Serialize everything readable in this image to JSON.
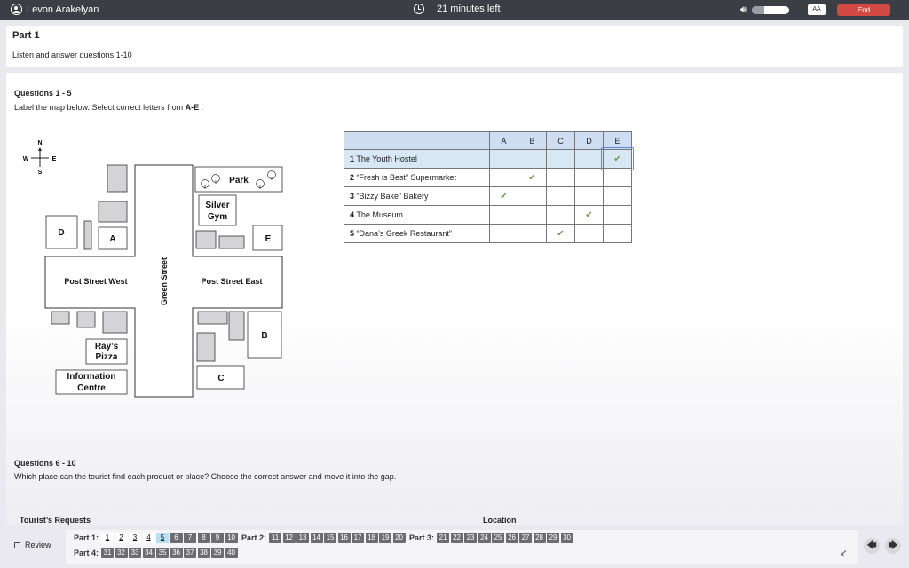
{
  "topbar": {
    "user_name": "Levon Arakelyan",
    "timer_text": "21 minutes left",
    "text_size_label": "AA",
    "end_label": "End"
  },
  "part": {
    "title": "Part 1",
    "instruction": "Listen and answer questions 1-10"
  },
  "section1": {
    "title": "Questions 1 - 5",
    "instruction_prefix": "Label the map below. Select correct letters from ",
    "instruction_bold": "A-E",
    "instruction_suffix": " ."
  },
  "map": {
    "compass": {
      "n": "N",
      "s": "S",
      "e": "E",
      "w": "W"
    },
    "labels": {
      "park": "Park",
      "silver_gym_1": "Silver",
      "silver_gym_2": "Gym",
      "d": "D",
      "a": "A",
      "e": "E",
      "b": "B",
      "c": "C",
      "post_west": "Post Street West",
      "post_east": "Post Street East",
      "green_street": "Green Street",
      "rays_1": "Ray’s",
      "rays_2": "Pizza",
      "info_1": "Information",
      "info_2": "Centre"
    }
  },
  "answer_table": {
    "columns": [
      "A",
      "B",
      "C",
      "D",
      "E"
    ],
    "rows": [
      {
        "number": "1",
        "label": "The Youth Hostel",
        "answer": "E"
      },
      {
        "number": "2",
        "label": "“Fresh is Best” Supermarket",
        "answer": "B"
      },
      {
        "number": "3",
        "label": "“Bizzy Bake” Bakery",
        "answer": "A"
      },
      {
        "number": "4",
        "label": "The Museum",
        "answer": "D"
      },
      {
        "number": "5",
        "label": "“Dana’s Greek Restaurant”",
        "answer": "C"
      }
    ]
  },
  "section2": {
    "title": "Questions 6 - 10",
    "instruction": "Which place can the tourist find each product or place? Choose the correct answer and move it into the gap.",
    "col_left": "Tourist’s Requests",
    "col_right": "Location"
  },
  "footer": {
    "review_label": "Review",
    "parts": [
      {
        "label": "Part 1:",
        "questions": [
          {
            "n": "1",
            "state": "answered"
          },
          {
            "n": "2",
            "state": "answered"
          },
          {
            "n": "3",
            "state": "answered"
          },
          {
            "n": "4",
            "state": "answered"
          },
          {
            "n": "5",
            "state": "current"
          },
          {
            "n": "6",
            "state": "unanswered"
          },
          {
            "n": "7",
            "state": "unanswered"
          },
          {
            "n": "8",
            "state": "unanswered"
          },
          {
            "n": "9",
            "state": "unanswered"
          },
          {
            "n": "10",
            "state": "unanswered"
          }
        ]
      },
      {
        "label": "Part 2:",
        "questions": [
          {
            "n": "11",
            "state": "unanswered"
          },
          {
            "n": "12",
            "state": "unanswered"
          },
          {
            "n": "13",
            "state": "unanswered"
          },
          {
            "n": "14",
            "state": "unanswered"
          },
          {
            "n": "15",
            "state": "unanswered"
          },
          {
            "n": "16",
            "state": "unanswered"
          },
          {
            "n": "17",
            "state": "unanswered"
          },
          {
            "n": "18",
            "state": "unanswered"
          },
          {
            "n": "19",
            "state": "unanswered"
          },
          {
            "n": "20",
            "state": "unanswered"
          }
        ]
      },
      {
        "label": "Part 3:",
        "questions": [
          {
            "n": "21",
            "state": "unanswered"
          },
          {
            "n": "22",
            "state": "unanswered"
          },
          {
            "n": "23",
            "state": "unanswered"
          },
          {
            "n": "24",
            "state": "unanswered"
          },
          {
            "n": "25",
            "state": "unanswered"
          },
          {
            "n": "26",
            "state": "unanswered"
          },
          {
            "n": "27",
            "state": "unanswered"
          },
          {
            "n": "28",
            "state": "unanswered"
          },
          {
            "n": "29",
            "state": "unanswered"
          },
          {
            "n": "30",
            "state": "unanswered"
          }
        ]
      },
      {
        "label": "Part 4:",
        "questions": [
          {
            "n": "31",
            "state": "unanswered"
          },
          {
            "n": "32",
            "state": "unanswered"
          },
          {
            "n": "33",
            "state": "unanswered"
          },
          {
            "n": "34",
            "state": "unanswered"
          },
          {
            "n": "35",
            "state": "unanswered"
          },
          {
            "n": "36",
            "state": "unanswered"
          },
          {
            "n": "37",
            "state": "unanswered"
          },
          {
            "n": "38",
            "state": "unanswered"
          },
          {
            "n": "39",
            "state": "unanswered"
          },
          {
            "n": "40",
            "state": "unanswered"
          }
        ]
      }
    ]
  },
  "colors": {
    "topbar_bg": "#3b3e45",
    "end_button": "#d24a43",
    "table_header": "#cfddf3",
    "table_highlight": "#d7e7f3",
    "check": "#6a9e48",
    "current_question": "#b8dff2",
    "unanswered_question": "#6d6d70"
  },
  "icons": {
    "user": "user-circle-icon",
    "timer": "alarm-clock-icon",
    "volume": "speaker-icon",
    "check": "check-mark-icon",
    "expand": "collapse-arrow-icon",
    "prev": "arrow-left-icon",
    "next": "arrow-right-icon"
  }
}
